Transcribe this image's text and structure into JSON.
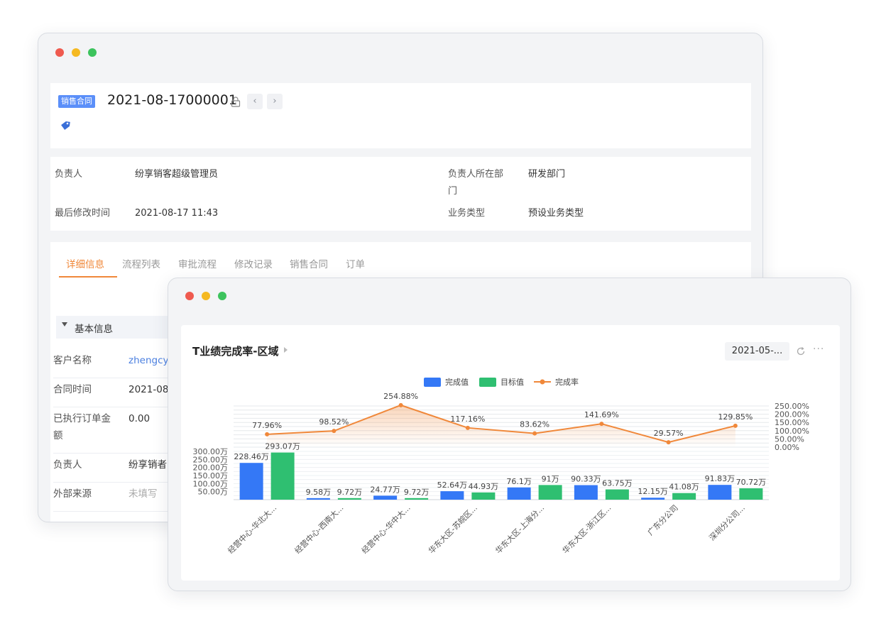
{
  "record": {
    "type_tag": "销售合同",
    "number": "2021-08-17000001"
  },
  "summary": {
    "owner_label": "负责人",
    "owner_value": "纷享销客超级管理员",
    "dept_label_line1": "负责人所在部",
    "dept_label_line2": "门",
    "dept_value": "研发部门",
    "modified_label": "最后修改时间",
    "modified_value": "2021-08-17 11:43",
    "biz_type_label": "业务类型",
    "biz_type_value": "预设业务类型"
  },
  "tabs": [
    "详细信息",
    "流程列表",
    "审批流程",
    "修改记录",
    "销售合同",
    "订单"
  ],
  "active_tab": 0,
  "section": {
    "title": "基本信息"
  },
  "fields": [
    {
      "label": "客户名称",
      "value": "zhengcy"
    },
    {
      "label": "合同时间",
      "value": "2021-08"
    },
    {
      "label_line1": "已执行订单金",
      "label_line2": "额",
      "value": "0.00"
    },
    {
      "label": "负责人",
      "value": "纷享销者"
    },
    {
      "label": "外部来源",
      "value": "未填写"
    }
  ],
  "chart_panel": {
    "title": "T业绩完成率-区域",
    "date_filter": "2021-05-...",
    "more": "···"
  },
  "colors": {
    "completed": "#3478f6",
    "target": "#2fbf71",
    "rate": "#f0883a",
    "accent": "#f0883a",
    "tag_bg": "#5b8ff9"
  },
  "chart_data": {
    "type": "bar",
    "title": "T业绩完成率-区域",
    "categories": [
      "经营中心-华北大...",
      "经营中心-西南大...",
      "经营中心-华中大...",
      "华东大区-苏皖区...",
      "华东大区-上海分...",
      "华东大区-浙江区...",
      "广东分公司",
      "深圳分公司..."
    ],
    "series": [
      {
        "name": "完成值",
        "type": "bar",
        "values": [
          228.46,
          9.58,
          24.77,
          52.64,
          76.1,
          90.33,
          12.15,
          91.83
        ],
        "labels": [
          "228.46万",
          "9.58万",
          "24.77万",
          "52.64万",
          "76.1万",
          "90.33万",
          "12.15万",
          "91.83万"
        ]
      },
      {
        "name": "目标值",
        "type": "bar",
        "values": [
          293.07,
          9.72,
          9.72,
          44.93,
          91,
          63.75,
          41.08,
          70.72
        ],
        "labels": [
          "293.07万",
          "9.72万",
          "9.72万",
          "44.93万",
          "91万",
          "63.75万",
          "41.08万",
          "70.72万"
        ]
      },
      {
        "name": "完成率",
        "type": "line",
        "values": [
          77.96,
          98.52,
          254.88,
          117.16,
          83.62,
          141.69,
          29.57,
          129.85
        ],
        "labels": [
          "77.96%",
          "98.52%",
          "254.88%",
          "117.16%",
          "83.62%",
          "141.69%",
          "29.57%",
          "129.85%"
        ]
      }
    ],
    "y_left_ticks": [
      "50.00万",
      "100.00万",
      "150.00万",
      "200.00万",
      "250.00万",
      "300.00万"
    ],
    "ylim_left": [
      0,
      300
    ],
    "y_right_ticks": [
      "0.00%",
      "50.00%",
      "100.00%",
      "150.00%",
      "200.00%",
      "250.00%"
    ],
    "ylim_right": [
      0,
      250
    ],
    "legend_position": "top-center",
    "grid": true
  }
}
